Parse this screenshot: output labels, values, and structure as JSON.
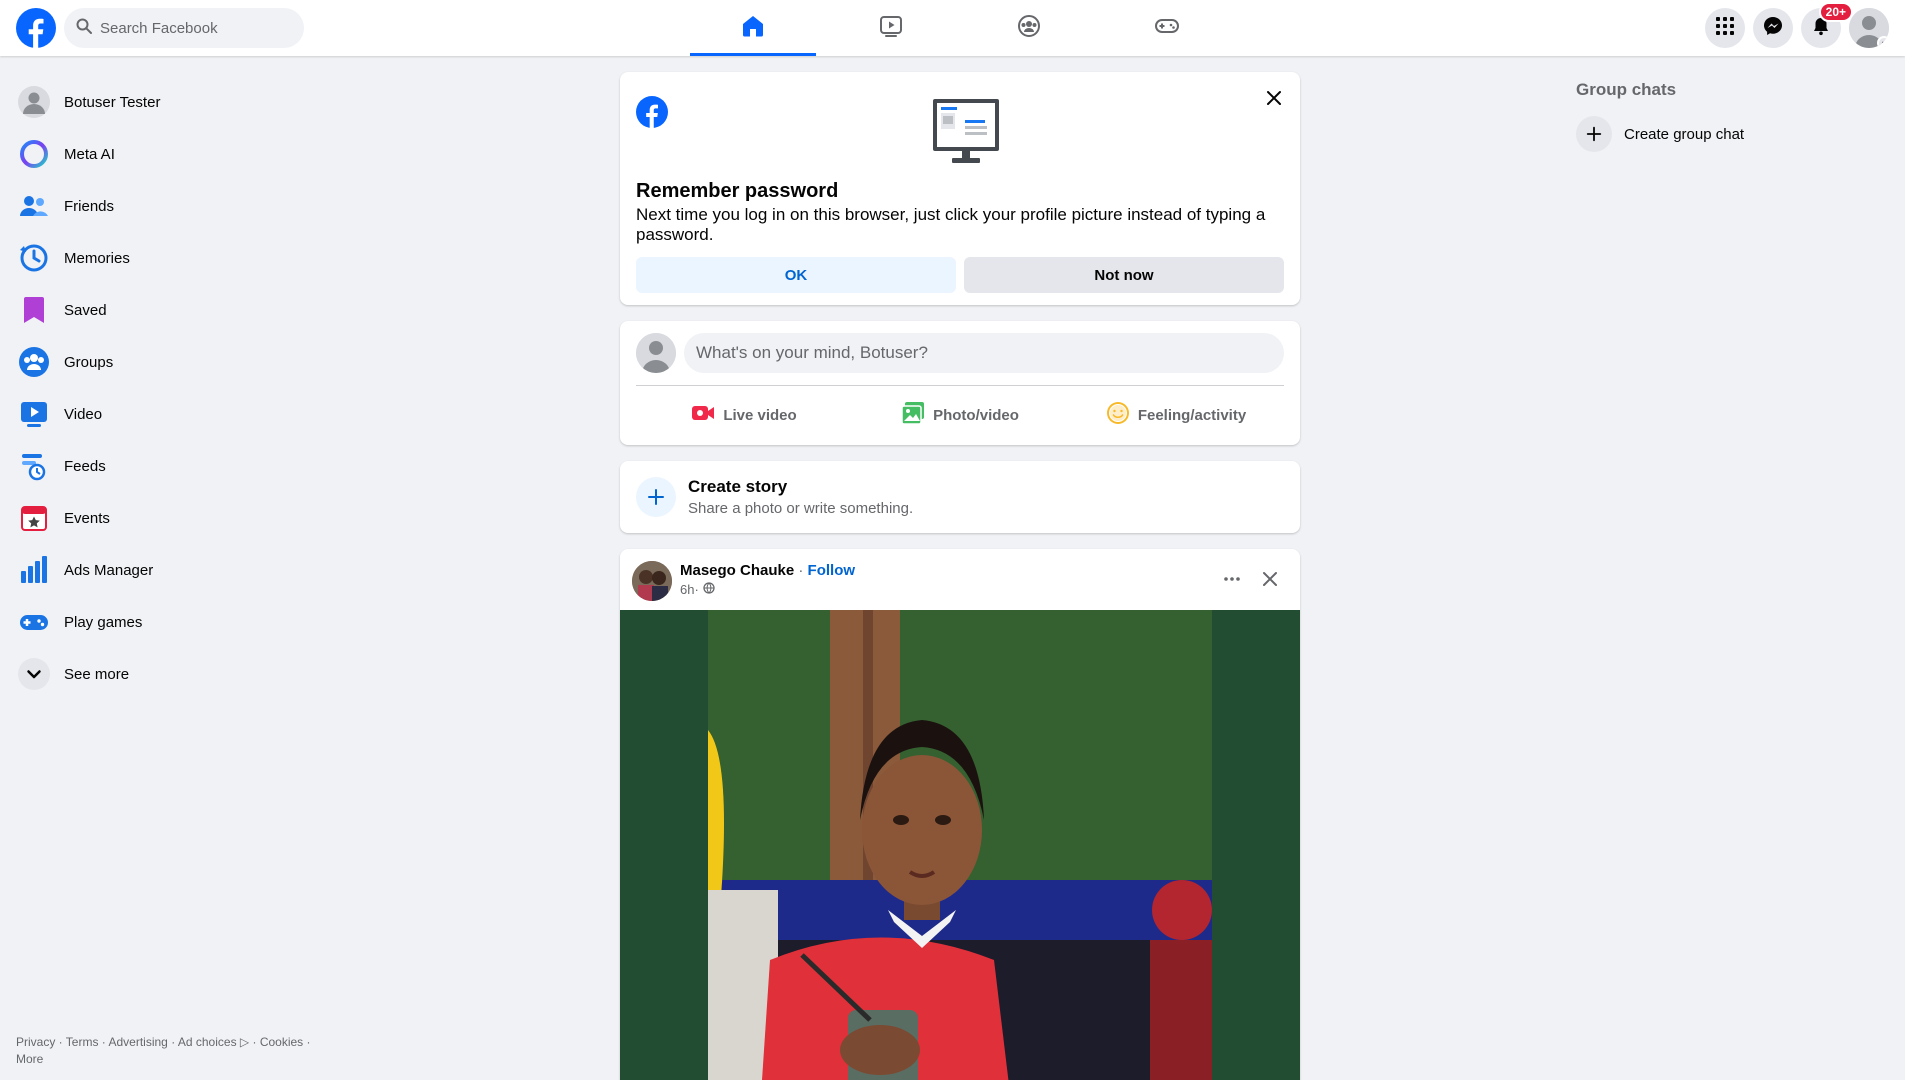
{
  "colors": {
    "brand_blue": "#0866ff",
    "page_bg": "#f0f2f5",
    "badge_red": "#e41e3f"
  },
  "header": {
    "logo": "facebook-logo-icon",
    "search": {
      "placeholder": "Search Facebook",
      "icon": "search-icon"
    },
    "tabs": [
      {
        "name": "home",
        "icon": "home-icon",
        "active": true
      },
      {
        "name": "video",
        "icon": "video-icon",
        "active": false
      },
      {
        "name": "groups",
        "icon": "groups-icon",
        "active": false
      },
      {
        "name": "gaming",
        "icon": "gaming-icon",
        "active": false
      }
    ],
    "right": {
      "menu_icon": "grid-menu-icon",
      "messenger_icon": "messenger-icon",
      "notifications_icon": "bell-icon",
      "notifications_badge": "20+"
    }
  },
  "sidebar": {
    "items": [
      {
        "label": "Botuser Tester",
        "icon": "profile-avatar-icon"
      },
      {
        "label": "Meta AI",
        "icon": "meta-ai-icon"
      },
      {
        "label": "Friends",
        "icon": "friends-icon"
      },
      {
        "label": "Memories",
        "icon": "memories-icon"
      },
      {
        "label": "Saved",
        "icon": "saved-icon"
      },
      {
        "label": "Groups",
        "icon": "groups-icon"
      },
      {
        "label": "Video",
        "icon": "video-icon"
      },
      {
        "label": "Feeds",
        "icon": "feeds-icon"
      },
      {
        "label": "Events",
        "icon": "events-icon"
      },
      {
        "label": "Ads Manager",
        "icon": "ads-manager-icon"
      },
      {
        "label": "Play games",
        "icon": "play-games-icon"
      },
      {
        "label": "See more",
        "icon": "chevron-down-icon"
      }
    ],
    "footer": {
      "privacy": "Privacy",
      "terms": "Terms",
      "advertising": "Advertising",
      "ad_choices": "Ad choices",
      "cookies": "Cookies",
      "more": "More"
    }
  },
  "remember_password": {
    "title": "Remember password",
    "body": "Next time you log in on this browser, just click your profile picture instead of typing a password.",
    "ok_label": "OK",
    "not_now_label": "Not now"
  },
  "composer": {
    "placeholder": "What's on your mind, Botuser?",
    "actions": [
      {
        "label": "Live video",
        "icon": "live-video-icon"
      },
      {
        "label": "Photo/video",
        "icon": "photo-video-icon"
      },
      {
        "label": "Feeling/activity",
        "icon": "feeling-icon"
      }
    ]
  },
  "story": {
    "title": "Create story",
    "subtitle": "Share a photo or write something."
  },
  "post": {
    "author": "Masego Chauke",
    "separator": " · ",
    "follow": "Follow",
    "time": "6h",
    "time_separator": " ·"
  },
  "right_column": {
    "title": "Group chats",
    "create_label": "Create group chat"
  }
}
